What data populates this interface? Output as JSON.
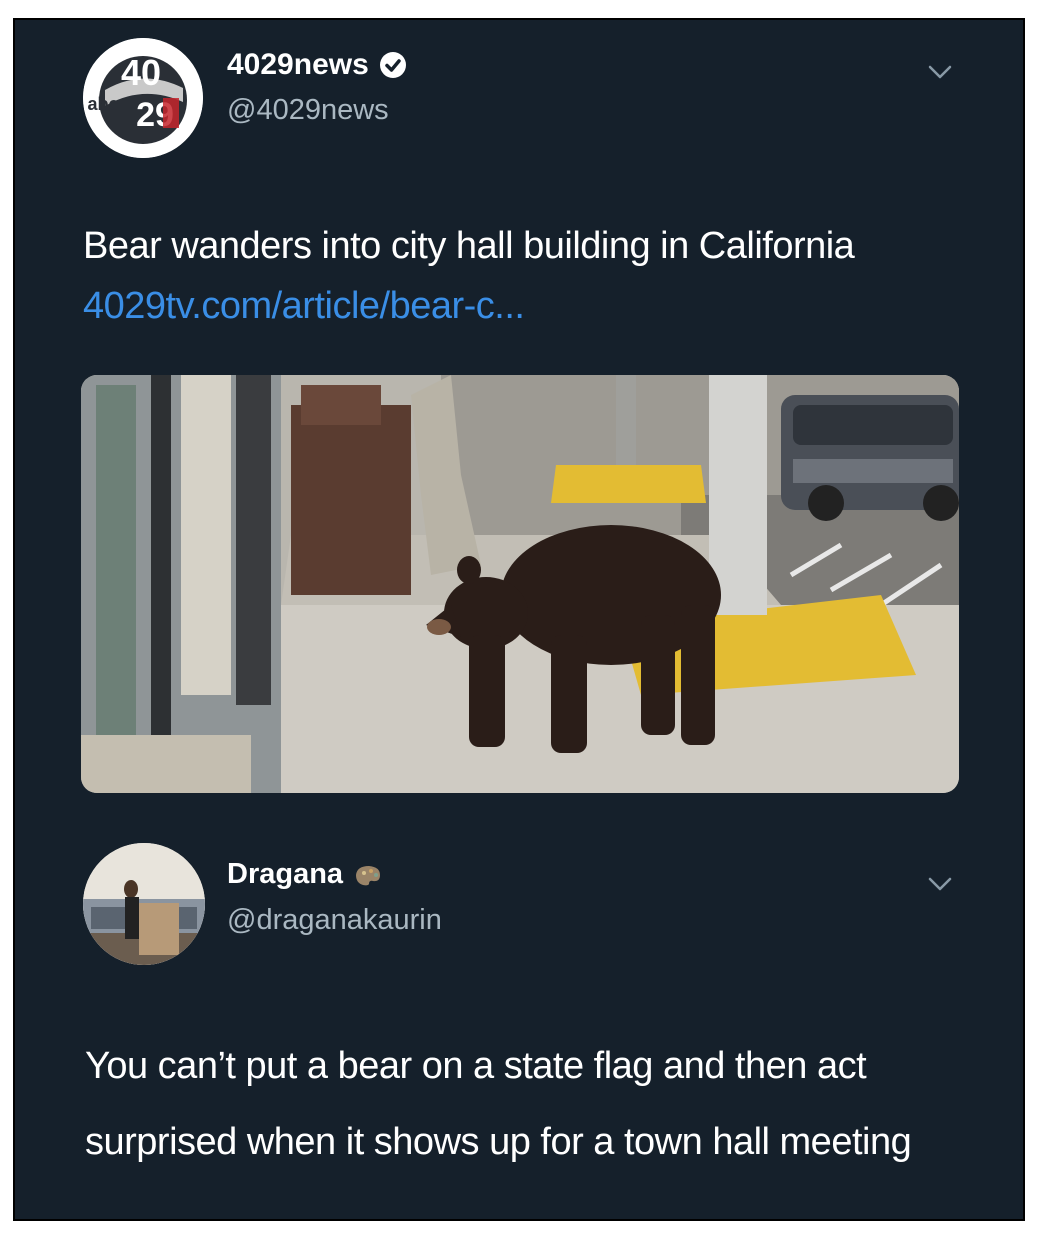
{
  "tweet1": {
    "display_name": "4029news",
    "handle": "@4029news",
    "verified": true,
    "text": "Bear wanders into city hall building in California ",
    "link_text": "4029tv.com/article/bear-c...",
    "avatar": {
      "icon": "abc-4029-logo-icon",
      "logo_top": "40",
      "logo_bottom": "29",
      "logo_word": "abc"
    },
    "image": {
      "icon": "bear-on-sidewalk-image"
    }
  },
  "tweet2": {
    "display_name": "Dragana",
    "handle": "@draganakaurin",
    "badge_icon": "paint-palette-icon",
    "text": "You can’t put a bear on a state flag and then act surprised when it shows up for a town hall meeting",
    "avatar": {
      "icon": "profile-photo-icon"
    }
  },
  "colors": {
    "background": "#15202b",
    "text": "#ffffff",
    "secondary": "#aab8c2",
    "link": "#3a8ee6"
  }
}
